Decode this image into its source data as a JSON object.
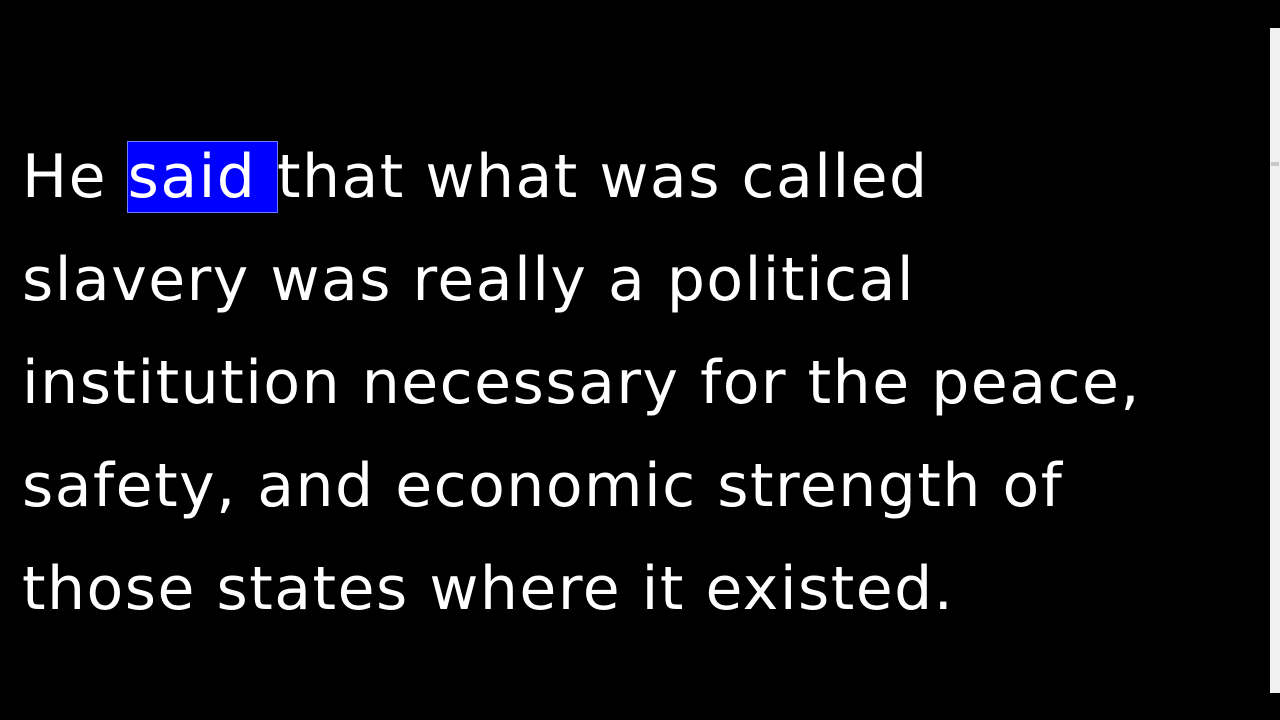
{
  "reader": {
    "lines": [
      {
        "before": "He ",
        "highlight": "said ",
        "after": "that what was called"
      },
      {
        "text": "slavery was really a political"
      },
      {
        "text": "institution necessary for the peace,"
      },
      {
        "text": "safety, and economic strength of"
      },
      {
        "text": "those states where it existed."
      }
    ],
    "highlight_color": "#0000ff",
    "text_color": "#ffffff",
    "background_color": "#000000"
  }
}
